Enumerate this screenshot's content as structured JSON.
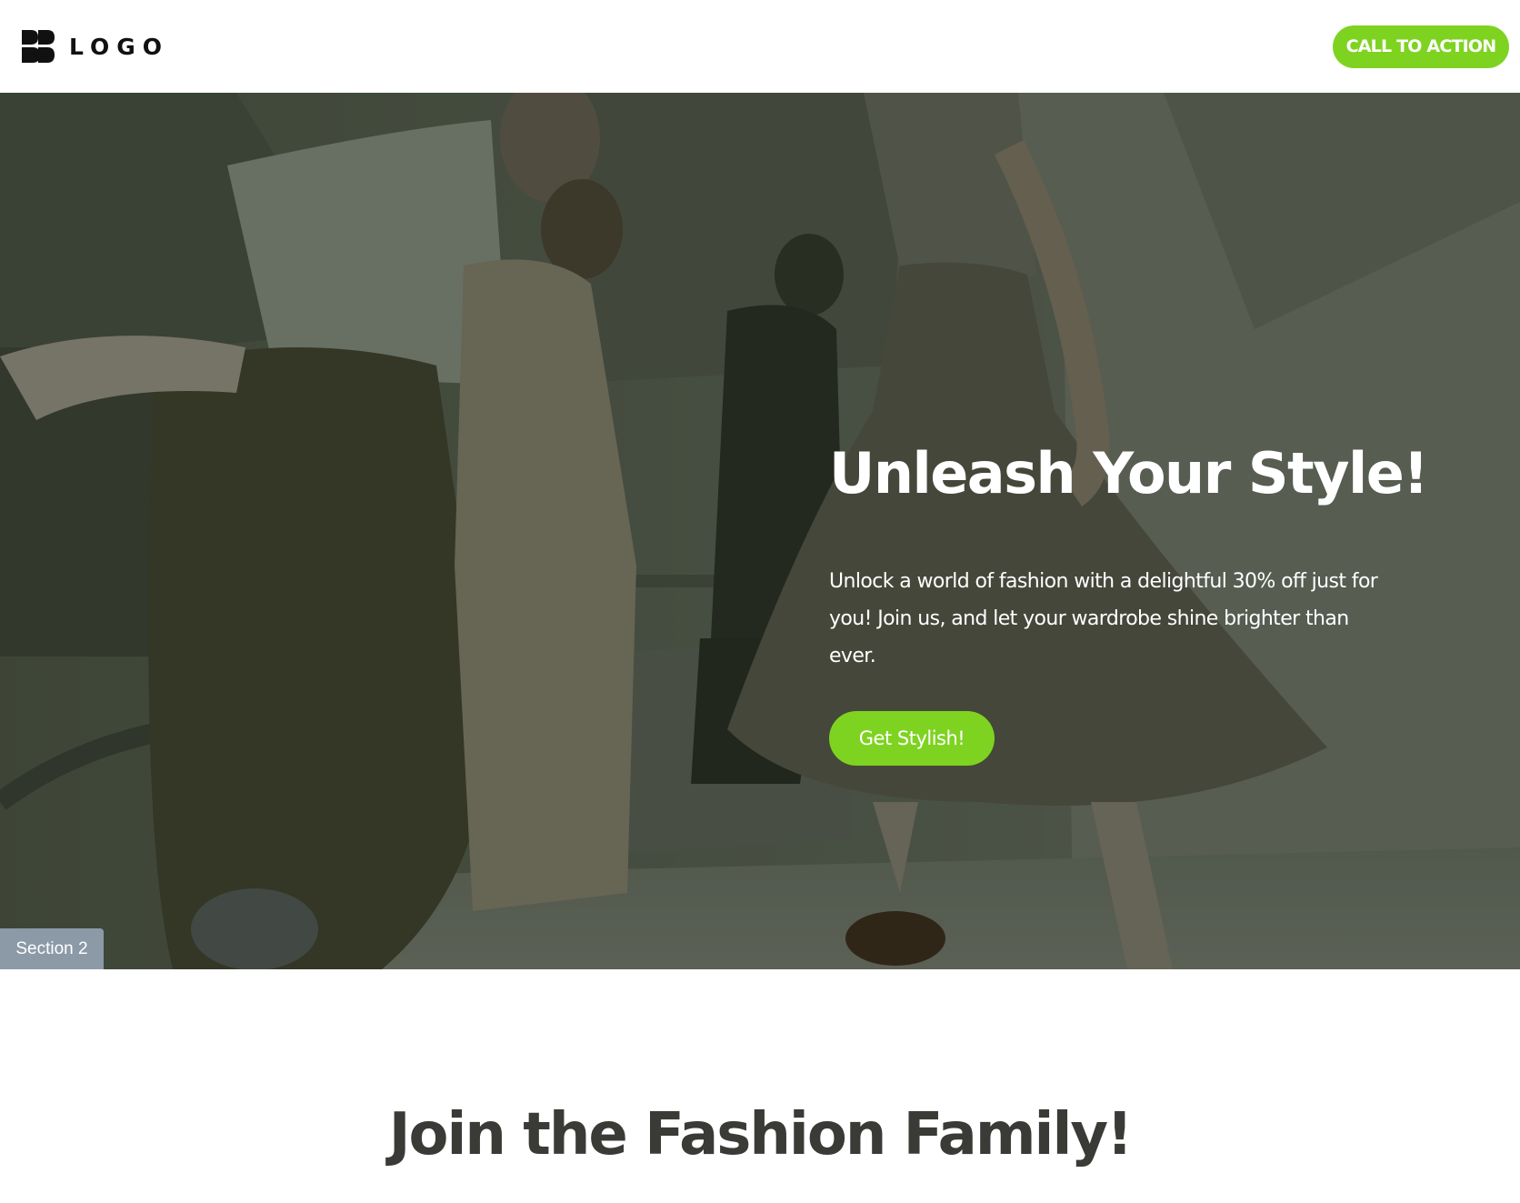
{
  "header": {
    "logo_text": "LOGO",
    "cta_label": "CALL TO ACTION"
  },
  "hero": {
    "title": "Unleash Your Style!",
    "text": "Unlock a world of fashion with a delightful 30% off just for you! Join us, and let your wardrobe shine brighter than ever.",
    "button_label": "Get Stylish!",
    "section_tag": "Section 2"
  },
  "join": {
    "title": "Join the Fashion Family!"
  },
  "colors": {
    "accent": "#7ed321",
    "heading_dark": "#3a3b36",
    "tag_bg": "#8c9aa8"
  },
  "icons": {
    "logo": "logo-mark-icon"
  }
}
